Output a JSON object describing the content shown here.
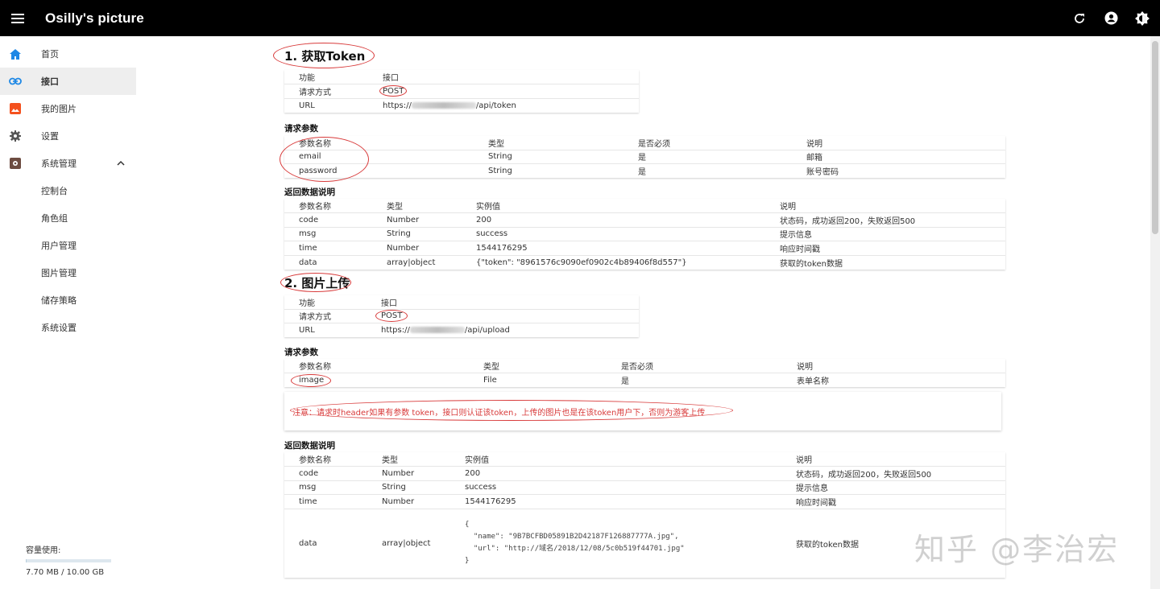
{
  "app": {
    "title": "Osilly's picture"
  },
  "sidebar": {
    "items": [
      {
        "label": "首页",
        "icon": "home-icon"
      },
      {
        "label": "接口",
        "icon": "link-icon"
      },
      {
        "label": "我的图片",
        "icon": "image-icon"
      },
      {
        "label": "设置",
        "icon": "gear-icon"
      },
      {
        "label": "系统管理",
        "icon": "admin-icon"
      }
    ],
    "sub_items": [
      "控制台",
      "角色组",
      "用户管理",
      "图片管理",
      "储存策略",
      "系统设置"
    ],
    "storage": {
      "label": "容量使用:",
      "value": "7.70 MB / 10.00 GB",
      "fraction": 0.00077
    }
  },
  "section1": {
    "title": "1. 获取Token",
    "info": [
      [
        "功能",
        "接口"
      ],
      [
        "请求方式",
        "POST"
      ],
      [
        "URL",
        "https://",
        "/api/token"
      ]
    ],
    "req_title": "请求参数",
    "req_head": [
      "参数名称",
      "类型",
      "是否必须",
      "说明"
    ],
    "req_rows": [
      [
        "email",
        "String",
        "是",
        "邮箱"
      ],
      [
        "password",
        "String",
        "是",
        "账号密码"
      ]
    ],
    "resp_title": "返回数据说明",
    "resp_head": [
      "参数名称",
      "类型",
      "实例值",
      "说明"
    ],
    "resp_rows": [
      [
        "code",
        "Number",
        "200",
        "状态码，成功返回200，失败返回500"
      ],
      [
        "msg",
        "String",
        "success",
        "提示信息"
      ],
      [
        "time",
        "Number",
        "1544176295",
        "响应时间戳"
      ],
      [
        "data",
        "array|object",
        "{\"token\": \"8961576c9090ef0902c4b89406f8d557\"}",
        "获取的token数据"
      ]
    ]
  },
  "section2": {
    "title": "2. 图片上传",
    "info": [
      [
        "功能",
        "接口"
      ],
      [
        "请求方式",
        "POST"
      ],
      [
        "URL",
        "https://",
        "/api/upload"
      ]
    ],
    "req_title": "请求参数",
    "req_head": [
      "参数名称",
      "类型",
      "是否必须",
      "说明"
    ],
    "req_rows": [
      [
        "image",
        "File",
        "是",
        "表单名称"
      ]
    ],
    "note": "注意：请求时header如果有参数 token，接口则认证该token，上传的图片也是在该token用户下，否则为游客上传",
    "resp_title": "返回数据说明",
    "resp_head": [
      "参数名称",
      "类型",
      "实例值",
      "说明"
    ],
    "resp_rows": [
      [
        "code",
        "Number",
        "200",
        "状态码，成功返回200，失败返回500"
      ],
      [
        "msg",
        "String",
        "success",
        "提示信息"
      ],
      [
        "time",
        "Number",
        "1544176295",
        "响应时间戳"
      ]
    ],
    "data_row": {
      "name": "data",
      "type": "array|object",
      "example": "{\n  \"name\": \"9B7BCFBD05891B2D42187F126887777A.jpg\",\n  \"url\": \"http://域名/2018/12/08/5c0b519f44701.jpg\"\n}",
      "desc": "获取的token数据"
    }
  },
  "watermark": "知乎 @李治宏",
  "colors": {
    "appbar": "#000000",
    "annotation": "#d83a3a",
    "active_nav": "#eeeeee",
    "link_icon": "#1e88e5",
    "image_icon": "#f4511e"
  }
}
